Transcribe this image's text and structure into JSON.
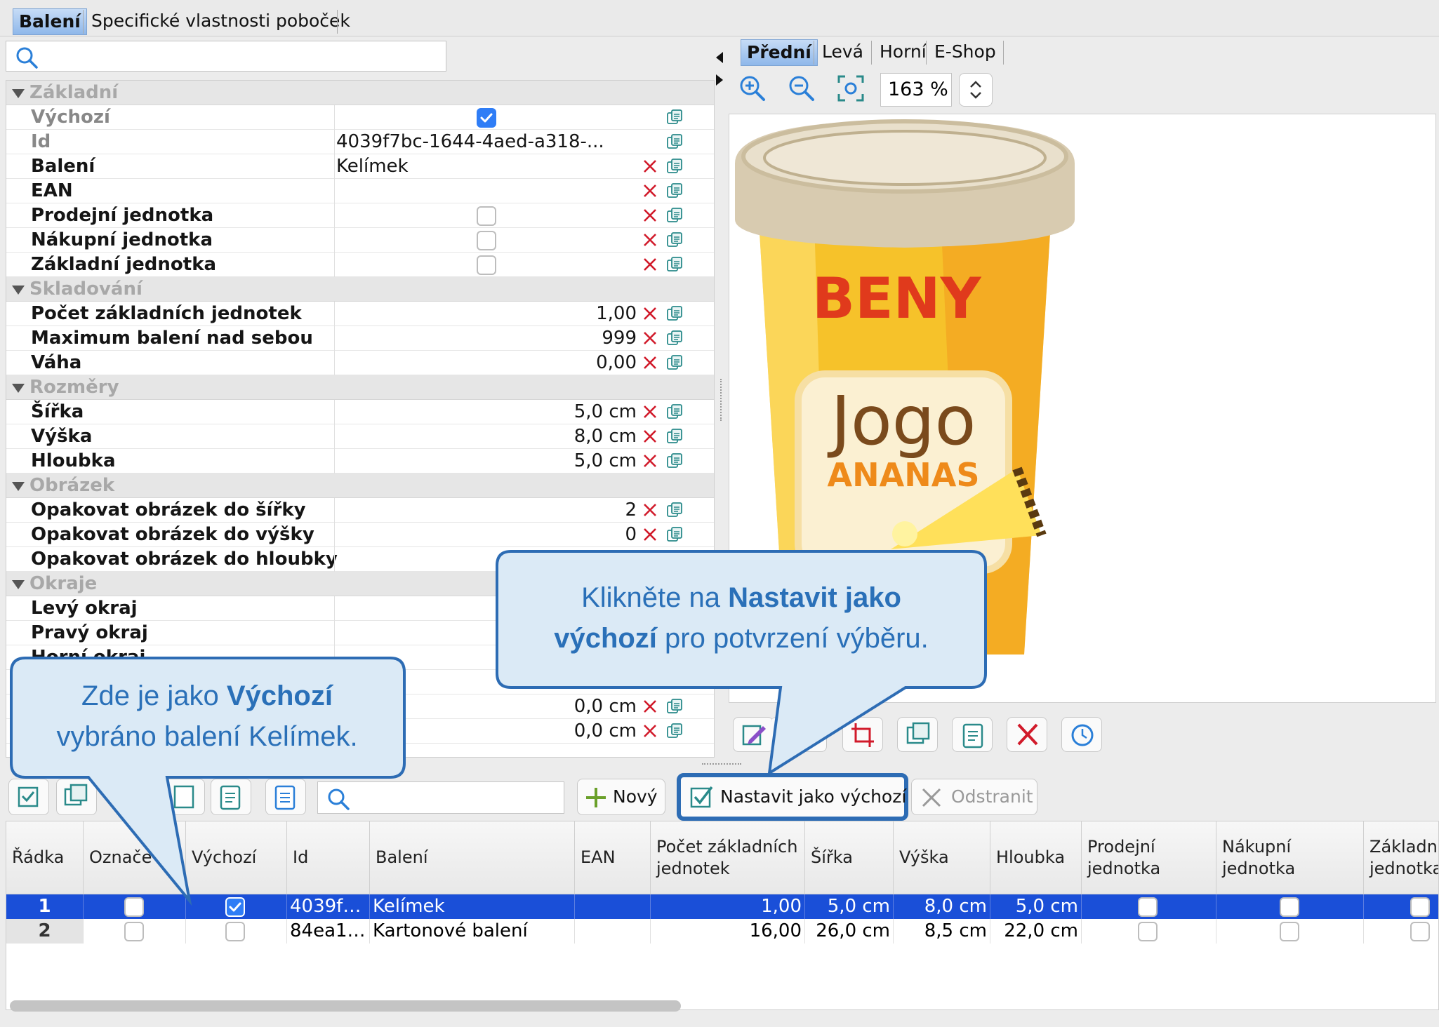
{
  "top_tabs": [
    {
      "label": "Balení",
      "active": true
    },
    {
      "label": "Specifické vlastnosti poboček",
      "active": false
    }
  ],
  "search": {
    "placeholder": ""
  },
  "property_grid": {
    "categories": {
      "zakladni": "Základní",
      "skladovani": "Skladování",
      "rozmery": "Rozměry",
      "obrazek": "Obrázek",
      "okraje": "Okraje"
    },
    "rows": {
      "vychozi": {
        "label": "Výchozí",
        "checked": true
      },
      "id": {
        "label": "Id",
        "value": "4039f7bc-1644-4aed-a318-..."
      },
      "baleni": {
        "label": "Balení",
        "value": "Kelímek"
      },
      "ean": {
        "label": "EAN",
        "value": ""
      },
      "prodejni": {
        "label": "Prodejní jednotka",
        "checked": false
      },
      "nakupni": {
        "label": "Nákupní jednotka",
        "checked": false
      },
      "zakladni_j": {
        "label": "Základní jednotka",
        "checked": false
      },
      "pocet": {
        "label": "Počet základních jednotek",
        "value": "1,00"
      },
      "maximum": {
        "label": "Maximum balení nad sebou",
        "value": "999"
      },
      "vaha": {
        "label": "Váha",
        "value": "0,00"
      },
      "sirka": {
        "label": "Šířka",
        "value": "5,0 cm"
      },
      "vyska": {
        "label": "Výška",
        "value": "8,0 cm"
      },
      "hloubka": {
        "label": "Hloubka",
        "value": "5,0 cm"
      },
      "opak_sirka": {
        "label": "Opakovat obrázek do šířky",
        "value": "2"
      },
      "opak_vyska": {
        "label": "Opakovat obrázek do výšky",
        "value": "0"
      },
      "opak_hloubka": {
        "label": "Opakovat obrázek do hloubky",
        "value": ""
      },
      "levy": {
        "label": "Levý okraj",
        "value": ""
      },
      "pravy": {
        "label": "Pravý okraj",
        "value": ""
      },
      "horni": {
        "label": "Horní okraj",
        "value": ""
      },
      "extra1": {
        "label": "",
        "value": "0,0 cm"
      },
      "extra2": {
        "label": "",
        "value": "0,0 cm"
      }
    }
  },
  "image_panel": {
    "tabs": [
      {
        "label": "Přední",
        "active": true
      },
      {
        "label": "Levá",
        "active": false
      },
      {
        "label": "Horní",
        "active": false
      },
      {
        "label": "E-Shop",
        "active": false
      }
    ],
    "zoom": "163 %",
    "product": {
      "brand": "BENY",
      "name": "Jogo",
      "flavor": "ANANAS"
    }
  },
  "bottom_toolbar": {
    "new_label": "Nový",
    "set_default_label": "Nastavit jako výchozí",
    "remove_label": "Odstranit"
  },
  "table": {
    "headers": [
      "Řádka",
      "Označe",
      "Výchozí",
      "Id",
      "Balení",
      "EAN",
      "Počet základních jednotek",
      "Šířka",
      "Výška",
      "Hloubka",
      "Prodejní jednotka",
      "Nákupní jednotka",
      "Základní jednotka"
    ],
    "rows": [
      {
        "radka": "1",
        "oznacen": false,
        "vychozi": true,
        "id": "4039f…",
        "baleni": "Kelímek",
        "ean": "",
        "pocet": "1,00",
        "sirka": "5,0 cm",
        "vyska": "8,0 cm",
        "hloubka": "5,0 cm",
        "selected": true
      },
      {
        "radka": "2",
        "oznacen": false,
        "vychozi": false,
        "id": "84ea1…",
        "baleni": "Kartonové balení",
        "ean": "",
        "pocet": "16,00",
        "sirka": "26,0 cm",
        "vyska": "8,5 cm",
        "hloubka": "22,0 cm",
        "selected": false
      }
    ]
  },
  "callouts": {
    "left": {
      "pre": "Zde je jako ",
      "bold": "Výchozí",
      "post": "vybráno balení Kelímek."
    },
    "right": {
      "pre": "Klikněte na ",
      "bold1": "Nastavit jako",
      "bold2": "výchozí",
      "post": " pro potvrzení výběru."
    }
  },
  "colors": {
    "selection": "#1a4fd8",
    "accent": "#2d6cb4",
    "callout_text": "#2a70b8"
  }
}
